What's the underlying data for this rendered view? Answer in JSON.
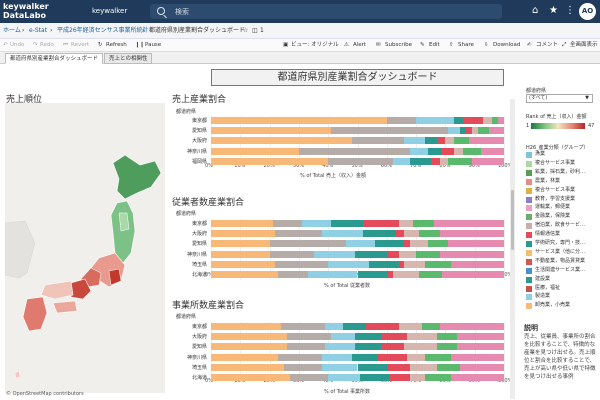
{
  "app": {
    "logo_line1": "keywalker",
    "logo_line2": "DataLabo",
    "user_name": "keywalker",
    "search_placeholder": "検索",
    "avatar_initials": "AO"
  },
  "breadcrumb": {
    "home": "ホーム",
    "sep": "›",
    "estat": "e-Stat",
    "survey": "平成26年経済センサス事業所統計",
    "current": "都道府県別産業割合ダッシュボード",
    "version_count": "1"
  },
  "toolbar": {
    "undo": "Undo",
    "redo": "Redo",
    "revert": "Revert",
    "refresh": "Refresh",
    "pause": "Pause",
    "view": "ビュー: オリジナル",
    "alert": "Alert",
    "subscribe": "Subscribe",
    "edit": "Edit",
    "share": "Share",
    "download": "Download",
    "comments": "コメント",
    "fullscreen": "全画面表示"
  },
  "tabs": [
    {
      "label": "都道府県別産業割合ダッシュボード",
      "active": true
    },
    {
      "label": "売上との相関性",
      "active": false
    }
  ],
  "dashboard": {
    "title": "都道府県別産業割合ダッシュボード",
    "map_title": "売上順位",
    "map_credit": "© OpenStreetMap contributors"
  },
  "colors": {
    "retail": "#f8b878",
    "wholesale": "#b5aca8",
    "manufacturing": "#8fd0e4",
    "construction": "#2a9a8e",
    "real_estate": "#e34a5a",
    "education": "#d8b6b0",
    "finance": "#5ab96c",
    "transport": "#e68ab0",
    "medical": "#cc4f4f",
    "other": "#999999"
  },
  "chart_data": [
    {
      "type": "bar",
      "title": "売上産業割合",
      "row_header": "都道府県",
      "xlabel": "% of Total 売上（収入）金額",
      "xlim": [
        0,
        100
      ],
      "x_ticks": [
        "0%",
        "10%",
        "20%",
        "30%",
        "40%",
        "50%",
        "60%",
        "70%",
        "80%",
        "90%",
        "100%"
      ],
      "categories": [
        "東京都",
        "愛知県",
        "大阪府",
        "神奈川県",
        "福岡県"
      ],
      "series": [
        {
          "name": "卸売業，小売業",
          "values": [
            60,
            41,
            48,
            30,
            40
          ]
        },
        {
          "name": "製造業",
          "values": [
            10,
            40,
            18,
            38,
            22
          ]
        },
        {
          "name": "金融業，保険業",
          "values": [
            13,
            4,
            7,
            6,
            6
          ]
        },
        {
          "name": "建設業",
          "values": [
            3,
            2,
            4,
            5,
            7
          ]
        },
        {
          "name": "情報通信業",
          "values": [
            7,
            2,
            3,
            4,
            3
          ]
        },
        {
          "name": "不動産業，物品賃貸業",
          "values": [
            3,
            2,
            3,
            3,
            3
          ]
        },
        {
          "name": "医療，福祉",
          "values": [
            2,
            4,
            5,
            6,
            8
          ]
        },
        {
          "name": "運輸業，郵便業",
          "values": [
            2,
            5,
            12,
            8,
            11
          ]
        }
      ]
    },
    {
      "type": "bar",
      "title": "従業者数産業割合",
      "row_header": "都道府県",
      "xlabel": "% of Total 従業者数",
      "xlim": [
        0,
        100
      ],
      "x_ticks": [
        "0%",
        "10%",
        "20%",
        "30%",
        "40%",
        "50%",
        "60%",
        "70%",
        "80%",
        "90%",
        "100%"
      ],
      "categories": [
        "東京都",
        "大阪府",
        "愛知県",
        "神奈川県",
        "埼玉県",
        "北海道"
      ],
      "series": [
        {
          "name": "卸売業，小売業",
          "values": [
            21,
            22,
            20,
            20,
            22,
            23
          ]
        },
        {
          "name": "製造業",
          "values": [
            10,
            16,
            26,
            15,
            18,
            10
          ]
        },
        {
          "name": "医療，福祉",
          "values": [
            10,
            14,
            10,
            14,
            14,
            17
          ]
        },
        {
          "name": "宿泊業，飲食サービス業",
          "values": [
            11,
            11,
            10,
            11,
            10,
            10
          ]
        },
        {
          "name": "情報通信業",
          "values": [
            12,
            3,
            2,
            4,
            2,
            2
          ]
        },
        {
          "name": "建設業",
          "values": [
            5,
            5,
            6,
            6,
            7,
            9
          ]
        },
        {
          "name": "運輸業，郵便業",
          "values": [
            7,
            7,
            7,
            8,
            9,
            8
          ]
        },
        {
          "name": "その他",
          "values": [
            24,
            22,
            19,
            22,
            18,
            21
          ]
        }
      ]
    },
    {
      "type": "bar",
      "title": "事業所数産業割合",
      "row_header": "都道府県",
      "xlabel": "% of Total 事業所数",
      "xlim": [
        0,
        100
      ],
      "x_ticks": [
        "0%",
        "10%",
        "20%",
        "30%",
        "40%",
        "50%",
        "60%",
        "70%",
        "80%",
        "90%",
        "100%"
      ],
      "categories": [
        "東京都",
        "大阪府",
        "愛知県",
        "神奈川県",
        "埼玉県",
        "北海道"
      ],
      "series": [
        {
          "name": "卸売業，小売業",
          "values": [
            24,
            26,
            26,
            23,
            25,
            27
          ]
        },
        {
          "name": "宿泊業，飲食サービス業",
          "values": [
            15,
            15,
            13,
            15,
            13,
            13
          ]
        },
        {
          "name": "建設業",
          "values": [
            6,
            8,
            10,
            10,
            12,
            11
          ]
        },
        {
          "name": "生活関連サービス業，娯楽業",
          "values": [
            8,
            9,
            9,
            9,
            10,
            10
          ]
        },
        {
          "name": "不動産業，物品賃貸業",
          "values": [
            11,
            9,
            8,
            10,
            8,
            7
          ]
        },
        {
          "name": "製造業",
          "values": [
            8,
            10,
            11,
            6,
            9,
            5
          ]
        },
        {
          "name": "医療，福祉",
          "values": [
            6,
            7,
            7,
            9,
            8,
            9
          ]
        },
        {
          "name": "その他",
          "values": [
            22,
            16,
            16,
            18,
            15,
            18
          ]
        }
      ]
    }
  ],
  "legend": {
    "filter_title": "都道府県",
    "filter_value": "(すべて)",
    "rank_title": "Rank of 売上（収入）金額",
    "rank_min": "1",
    "rank_max": "47",
    "group_title": "H26_産業分類（グループ）",
    "items": [
      {
        "label": "漁業",
        "color": "#7fc3d8"
      },
      {
        "label": "複合サービス事業",
        "color": "#a9d8a3"
      },
      {
        "label": "鉱業，採石業，砂利…",
        "color": "#5a9e55"
      },
      {
        "label": "農業，林業",
        "color": "#e88a8a"
      },
      {
        "label": "複合サービス事業",
        "color": "#d9b53f"
      },
      {
        "label": "教育，学習支援業",
        "color": "#8a7fc3"
      },
      {
        "label": "運輸業，郵便業",
        "color": "#e8a0c8"
      },
      {
        "label": "金融業，保険業",
        "color": "#6ab06a"
      },
      {
        "label": "宿泊業，飲食サービ…",
        "color": "#c8b0a8"
      },
      {
        "label": "情報通信業",
        "color": "#e34a5a"
      },
      {
        "label": "学術研究，専門・技…",
        "color": "#2a9a8e"
      },
      {
        "label": "サービス業（他に分…",
        "color": "#f0c070"
      },
      {
        "label": "不動産業，物品賃貸業",
        "color": "#d45454"
      },
      {
        "label": "生活関連サービス業…",
        "color": "#4a8fcf"
      },
      {
        "label": "建設業",
        "color": "#2a9a8e"
      },
      {
        "label": "医療，福祉",
        "color": "#cc4f4f"
      },
      {
        "label": "製造業",
        "color": "#8fd0e4"
      },
      {
        "label": "卸売業，小売業",
        "color": "#f8b878"
      }
    ]
  },
  "description": {
    "title": "説明",
    "body": "売上、従業員、事業所の割合を比較することで、特徴的な産業を見つけ出せる。売上順位と割合を比較することで、売上が高い県や低い県で特徴を見つけ出せる事例"
  }
}
